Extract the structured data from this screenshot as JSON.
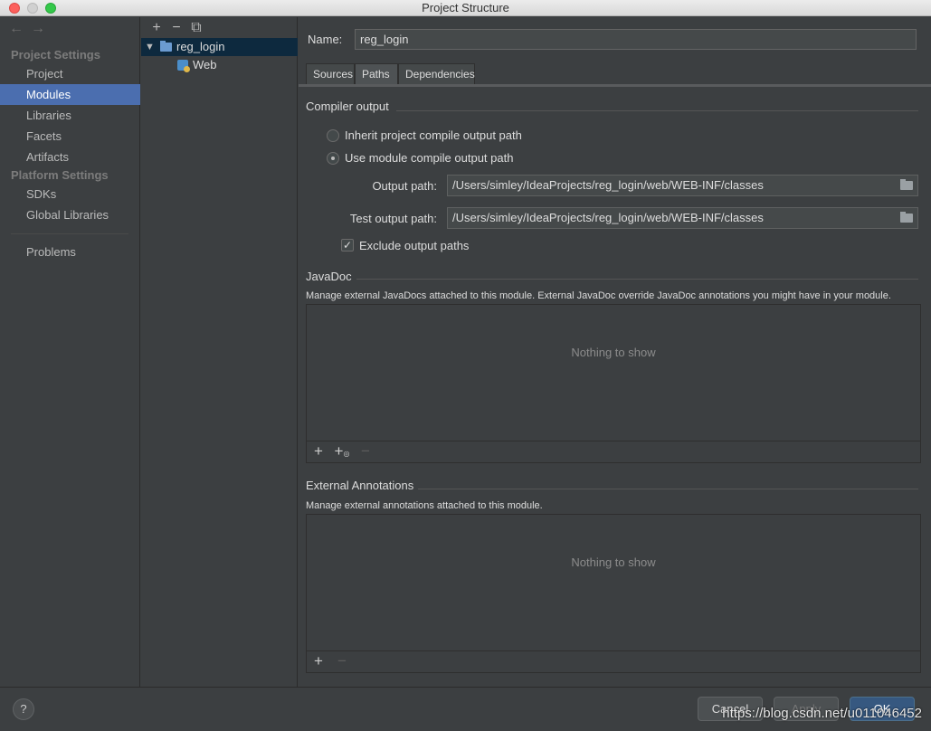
{
  "window": {
    "title": "Project Structure"
  },
  "sidebar": {
    "sections": [
      {
        "title": "Project Settings",
        "items": [
          "Project",
          "Modules",
          "Libraries",
          "Facets",
          "Artifacts"
        ]
      },
      {
        "title": "Platform Settings",
        "items": [
          "SDKs",
          "Global Libraries"
        ]
      }
    ],
    "selected": "Modules",
    "problems": "Problems"
  },
  "tree": {
    "toolbar": {
      "add": "+",
      "remove": "−",
      "copy": "⧉"
    },
    "nodes": [
      {
        "label": "reg_login",
        "type": "module",
        "expanded": true,
        "selected": true
      },
      {
        "label": "Web",
        "type": "facet"
      }
    ]
  },
  "module": {
    "name_label": "Name:",
    "name_value": "reg_login",
    "tabs": [
      "Sources",
      "Paths",
      "Dependencies"
    ],
    "active_tab": "Paths"
  },
  "compiler_output": {
    "title": "Compiler output",
    "options": [
      {
        "label": "Inherit project compile output path",
        "checked": false
      },
      {
        "label": "Use module compile output path",
        "checked": true
      }
    ],
    "output_path_label": "Output path:",
    "output_path": "/Users/simley/IdeaProjects/reg_login/web/WEB-INF/classes",
    "test_output_path_label": "Test output path:",
    "test_output_path": "/Users/simley/IdeaProjects/reg_login/web/WEB-INF/classes",
    "exclude_label": "Exclude output paths",
    "exclude_checked": true
  },
  "javadoc": {
    "title": "JavaDoc",
    "description": "Manage external JavaDocs attached to this module. External JavaDoc override JavaDoc annotations you might have in your module.",
    "empty_text": "Nothing to show"
  },
  "annotations": {
    "title": "External Annotations",
    "description": "Manage external annotations attached to this module.",
    "empty_text": "Nothing to show"
  },
  "footer": {
    "help": "?",
    "cancel": "Cancel",
    "apply": "Apply",
    "ok": "OK",
    "watermark": "https://blog.csdn.net/u011046452"
  },
  "colors": {
    "selection": "#4b6eaf",
    "primary_button": "#365880",
    "background": "#3c3f41"
  }
}
